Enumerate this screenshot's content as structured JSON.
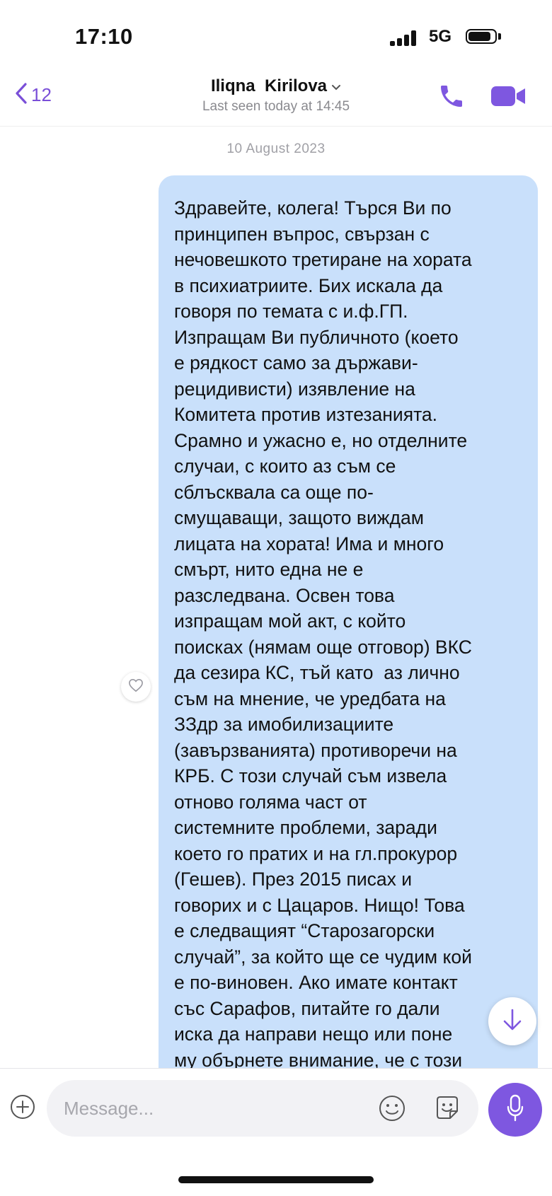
{
  "status_bar": {
    "time": "17:10",
    "network": "5G",
    "battery_level": 0.85
  },
  "header": {
    "back_count": "12",
    "contact_name": "Iliqna  Kirilova",
    "last_seen": "Last seen today at 14:45",
    "icons": {
      "back": "chevron-left-icon",
      "call": "phone-icon",
      "video": "video-camera-icon"
    }
  },
  "chat": {
    "date_separator": "10 August 2023",
    "message": "Здравейте, колега! Търся Ви по\nпринципен въпрос, свързан с\nнечовешкото третиране на хората\nв психиатриите. Бих искала да\nговоря по темата с и.ф.ГП.\nИзпращам Ви публичното (което\nе рядкост само за държави-\nрецидивисти) изявление на\nКомитета против изтезанията.\nСрамно и ужасно е, но отделните\nслучаи, с които аз съм се\nсблъсквала са още по-\nсмущаващи, защото виждам\nлицата на хората! Има и много\nсмърт, нито една не е\nразследвана. Освен това\nизпращам мой акт, с който\nпоисках (нямам още отговор) ВКС\nда сезира КС, тъй като  аз лично\nсъм на мнение, че уредбата на\nЗЗдр за имобилизациите\n(завързванията) противоречи на\nКРБ. С този случай съм извела\nотново голяма част от\nсистемните проблеми, заради\nкоето го пратих и на гл.прокурор\n(Гешев). През 2015 писах и\nговорих и с Цацаров. Нищо! Това\nе следващият “Старозагорски\nслучай”, за който ще се чудим кой\nе по-виновен. Ако имате контакт\nсъс Сарафов, питайте го дали\nиска да направи нещо или поне\nму обърнете внимание, че с този",
    "bubble_color": "#c9e0fb"
  },
  "composer": {
    "placeholder": "Message...",
    "accent_color": "#7e57e0",
    "icons": {
      "attach": "plus-circle-icon",
      "emoji": "smiley-icon",
      "sticker": "sticker-icon",
      "voice": "microphone-icon"
    }
  }
}
